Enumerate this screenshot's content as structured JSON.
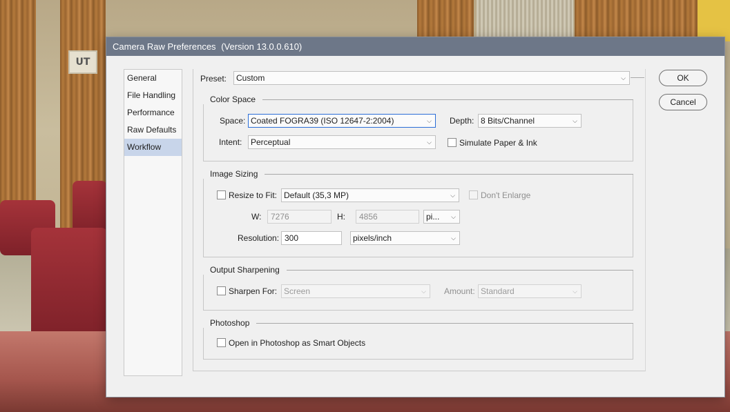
{
  "window": {
    "title": "Camera Raw Preferences",
    "version": "(Version 13.0.0.610)"
  },
  "sidebar": {
    "items": [
      {
        "label": "General"
      },
      {
        "label": "File Handling"
      },
      {
        "label": "Performance"
      },
      {
        "label": "Raw Defaults"
      },
      {
        "label": "Workflow",
        "selected": true
      }
    ]
  },
  "preset": {
    "label": "Preset:",
    "value": "Custom"
  },
  "color_space": {
    "title": "Color Space",
    "space_label": "Space:",
    "space_value": "Coated FOGRA39 (ISO 12647-2:2004)",
    "depth_label": "Depth:",
    "depth_value": "8 Bits/Channel",
    "intent_label": "Intent:",
    "intent_value": "Perceptual",
    "simulate_label": "Simulate Paper & Ink",
    "simulate_checked": false
  },
  "image_sizing": {
    "title": "Image Sizing",
    "resize_label": "Resize to Fit:",
    "resize_checked": false,
    "resize_value": "Default  (35,3 MP)",
    "dont_enlarge_label": "Don't Enlarge",
    "w_label": "W:",
    "w_value": "7276",
    "h_label": "H:",
    "h_value": "4856",
    "unit_value": "pi...",
    "resolution_label": "Resolution:",
    "resolution_value": "300",
    "resolution_unit": "pixels/inch"
  },
  "output_sharpening": {
    "title": "Output Sharpening",
    "sharpen_label": "Sharpen For:",
    "sharpen_checked": false,
    "sharpen_value": "Screen",
    "amount_label": "Amount:",
    "amount_value": "Standard"
  },
  "photoshop": {
    "title": "Photoshop",
    "smart_objects_label": "Open in Photoshop as Smart Objects",
    "smart_objects_checked": false
  },
  "buttons": {
    "ok": "OK",
    "cancel": "Cancel"
  },
  "background": {
    "sign_text": "UT"
  },
  "colors": {
    "titlebar": "#6d7788",
    "selection": "#c8d5ea",
    "focus": "#2a6dd7"
  }
}
